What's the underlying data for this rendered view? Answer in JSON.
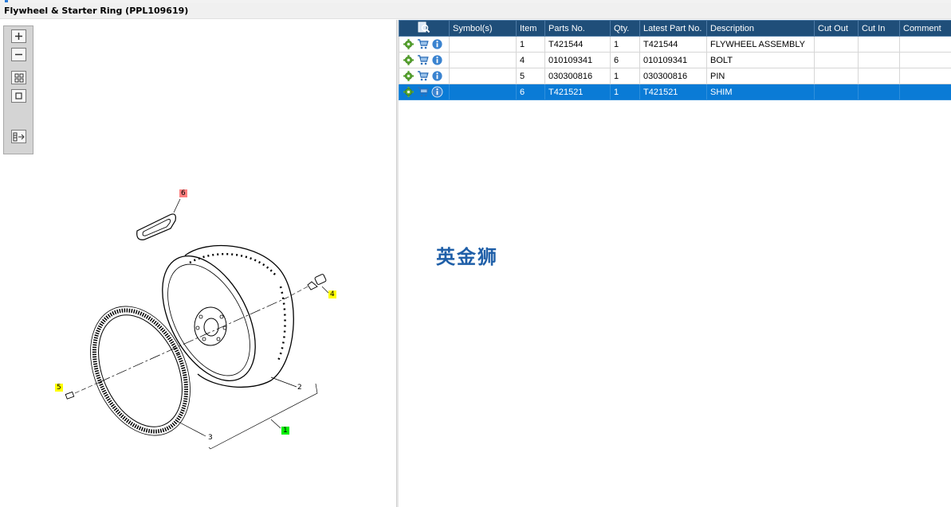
{
  "window": {
    "title": "Flywheel & Starter Ring (PPL109619)"
  },
  "toolbar": {
    "buttons": [
      {
        "name": "zoom-in-button",
        "icon": "plus-icon"
      },
      {
        "name": "zoom-out-button",
        "icon": "minus-icon"
      },
      {
        "name": "fit-all-button",
        "icon": "grid-icon"
      },
      {
        "name": "actual-size-button",
        "icon": "square-icon"
      },
      {
        "name": "export-button",
        "icon": "list-arrow-icon"
      }
    ]
  },
  "diagram": {
    "callouts": [
      {
        "label": "6",
        "highlight": "red"
      },
      {
        "label": "4",
        "highlight": "yellow"
      },
      {
        "label": "5",
        "highlight": "yellow"
      },
      {
        "label": "2",
        "highlight": "none"
      },
      {
        "label": "3",
        "highlight": "none"
      },
      {
        "label": "1",
        "highlight": "green"
      }
    ]
  },
  "table": {
    "columns": [
      "Symbol(s)",
      "Item",
      "Parts No.",
      "Qty.",
      "Latest Part No.",
      "Description",
      "Cut Out",
      "Cut In",
      "Comment"
    ],
    "rows": [
      {
        "item": "1",
        "part_no": "T421544",
        "qty": "1",
        "latest": "T421544",
        "description": "FLYWHEEL ASSEMBLY",
        "cut_out": "",
        "cut_in": "",
        "comment": "",
        "selected": false
      },
      {
        "item": "4",
        "part_no": "010109341",
        "qty": "6",
        "latest": "010109341",
        "description": "BOLT",
        "cut_out": "",
        "cut_in": "",
        "comment": "",
        "selected": false
      },
      {
        "item": "5",
        "part_no": "030300816",
        "qty": "1",
        "latest": "030300816",
        "description": "PIN",
        "cut_out": "",
        "cut_in": "",
        "comment": "",
        "selected": false
      },
      {
        "item": "6",
        "part_no": "T421521",
        "qty": "1",
        "latest": "T421521",
        "description": "SHIM",
        "cut_out": "",
        "cut_in": "",
        "comment": "",
        "selected": true
      }
    ]
  },
  "watermark": "英金狮",
  "colors": {
    "header_bg": "#1f4e79",
    "selected_row": "#0a7bd6",
    "callout_yellow": "#ffff00",
    "callout_red": "#ff8080",
    "callout_green": "#00ee00"
  }
}
